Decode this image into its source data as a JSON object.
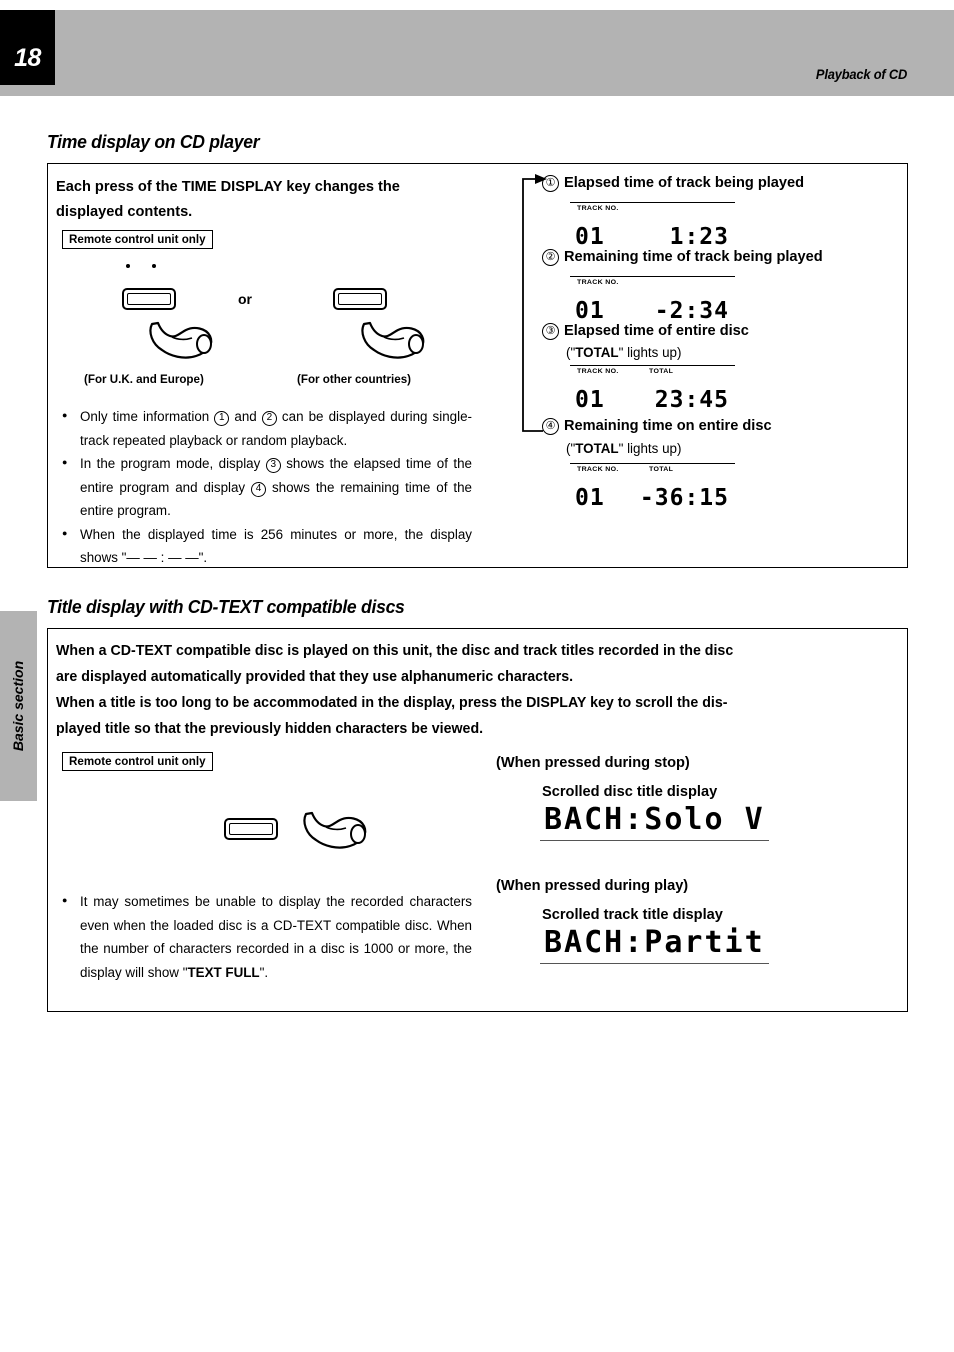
{
  "header": {
    "page_number": "18",
    "running_title": "Playback of CD"
  },
  "side_tab": {
    "label": "Basic section"
  },
  "section1": {
    "heading": "Time display on CD player",
    "lead_line1": "Each press of the TIME DISPLAY key changes the",
    "lead_line2": "displayed contents.",
    "remote_tag": "Remote control unit only",
    "or_label": "or",
    "caption_left": "(For U.K. and Europe)",
    "caption_right": "(For other countries)",
    "bullets": [
      "Only time information ① and ② can be displayed during single-track repeated playback or random playback.",
      "In the program mode, display ③ shows the elapsed time of the entire program and display ④ shows the remaining time of the entire program.",
      "When the displayed time is 256 minutes or more, the display shows \"— — : — —\"."
    ],
    "items": [
      {
        "num": "①",
        "title": "Elapsed time of track being played",
        "note": "",
        "lcd": {
          "track_label": "TRACK NO.",
          "total_label": "",
          "track_value": "01",
          "time_value": "1:23"
        }
      },
      {
        "num": "②",
        "title": "Remaining time of track being played",
        "note": "",
        "lcd": {
          "track_label": "TRACK NO.",
          "total_label": "",
          "track_value": "01",
          "time_value": "-2:34"
        }
      },
      {
        "num": "③",
        "title": "Elapsed time of entire disc",
        "note_pre": "(\"",
        "note_bold": "TOTAL",
        "note_post": "\" lights up)",
        "lcd": {
          "track_label": "TRACK NO.",
          "total_label": "TOTAL",
          "track_value": "01",
          "time_value": "23:45"
        }
      },
      {
        "num": "④",
        "title": "Remaining time on entire disc",
        "note_pre": "(\"",
        "note_bold": "TOTAL",
        "note_post": "\" lights up)",
        "lcd": {
          "track_label": "TRACK NO.",
          "total_label": "TOTAL",
          "track_value": "01",
          "time_value": "-36:15"
        }
      }
    ]
  },
  "section2": {
    "heading": "Title display with CD-TEXT compatible discs",
    "intro_line1": "When a CD-TEXT compatible disc is played on this unit, the disc and track titles recorded in the disc",
    "intro_line2": "are displayed automatically provided that they use alphanumeric characters.",
    "intro_line3": "When a title is too long to be accommodated in the display, press the DISPLAY key to scroll the dis-",
    "intro_line4": "played title so that the previously hidden characters be viewed.",
    "remote_tag": "Remote control unit only",
    "bullet": "It may sometimes be unable to display the recorded characters even when the loaded disc is a CD-TEXT compatible disc. When the number of characters recorded in a disc is 1000 or more, the display will show \"",
    "bullet_bold": "TEXT FULL",
    "bullet_tail": "\".",
    "stop_label": "(When pressed during stop)",
    "stop_sub": "Scrolled disc title display",
    "stop_display": "BACH:Solo V",
    "play_label": "(When pressed during play)",
    "play_sub": "Scrolled track title display",
    "play_display": "BACH:Partit"
  },
  "colors": {
    "header_gray": "#b3b3b3",
    "ink": "#000000",
    "paper": "#ffffff"
  }
}
